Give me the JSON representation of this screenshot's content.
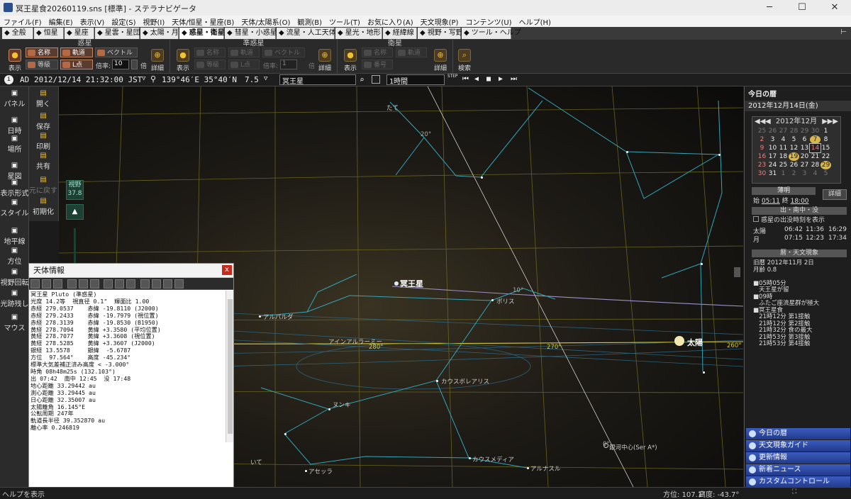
{
  "window": {
    "title": "冥王星食20260119.sns [標準] - ステラナビゲータ"
  },
  "menu": [
    "ファイル(F)",
    "編集(E)",
    "表示(V)",
    "設定(S)",
    "視野(I)",
    "天体/恒星・星座(B)",
    "天体/太陽系(O)",
    "観測(B)",
    "ツール(T)",
    "お気に入り(A)",
    "天文現象(P)",
    "コンテンツ(U)",
    "ヘルプ(H)"
  ],
  "tabs": [
    {
      "label": "全般",
      "icon": "panel-icon"
    },
    {
      "label": "恒星",
      "icon": "star-icon"
    },
    {
      "label": "星座",
      "icon": "constellation-icon"
    },
    {
      "label": "星雲・星団",
      "icon": "nebula-icon"
    },
    {
      "label": "太陽・月",
      "icon": "sun-icon"
    },
    {
      "label": "惑星・衛星",
      "icon": "planet-icon",
      "selected": true
    },
    {
      "label": "彗星・小惑星",
      "icon": "comet-icon"
    },
    {
      "label": "流星・人工天体",
      "icon": "meteor-icon"
    },
    {
      "label": "星光・地形",
      "icon": "landscape-icon"
    },
    {
      "label": "経緯線",
      "icon": "grid-icon"
    },
    {
      "label": "視野・写野",
      "icon": "fov-icon"
    },
    {
      "label": "ツール・ヘルプ",
      "icon": "tools-icon"
    }
  ],
  "ribbon": {
    "planets": {
      "title": "惑星",
      "show": "表示",
      "name": "名称",
      "orbit": "軌道",
      "vector": "ベクトル",
      "magnitude": "等級",
      "lpoint": "L点",
      "scale_label": "倍率:",
      "scale_value": "10",
      "scale_unit": "倍",
      "detail": "詳細"
    },
    "dwarf": {
      "title": "準惑星",
      "show": "表示",
      "name": "名称",
      "orbit": "軌道",
      "vector": "ベクトル",
      "magnitude": "等級",
      "lpoint": "L点",
      "scale_label": "倍率:",
      "scale_value": "1",
      "scale_unit": "倍",
      "detail": "詳細"
    },
    "satellites": {
      "title": "衛星",
      "show": "表示",
      "name": "名称",
      "orbit": "軌道",
      "number": "番号",
      "detail": "詳細"
    },
    "search": "検索"
  },
  "statusline": {
    "era": "AD",
    "datetime": "2012/12/14 21:32:00 JST",
    "location": "139°46′E 35°40′N",
    "height": "7.5",
    "target": "冥王星",
    "step": "1時間",
    "step_label": "STEP"
  },
  "leftbar": [
    {
      "label": "パネル",
      "icon": "panel-icon"
    },
    {
      "label": "日時",
      "icon": "clock-icon"
    },
    {
      "label": "場所",
      "icon": "location-icon"
    },
    {
      "label": "星図",
      "icon": "chart-icon"
    },
    {
      "label": "表示形式",
      "icon": "display-icon"
    },
    {
      "label": "スタイル",
      "icon": "style-icon"
    },
    {
      "label": "地平線",
      "icon": "horizon-icon"
    },
    {
      "label": "方位",
      "icon": "compass-icon"
    },
    {
      "label": "視野回転",
      "icon": "rotate-icon"
    },
    {
      "label": "光跡残し",
      "icon": "trail-icon"
    },
    {
      "label": "マウス",
      "icon": "mouse-icon"
    }
  ],
  "leftbar2": [
    {
      "label": "開く",
      "icon": "open-icon"
    },
    {
      "label": "保存",
      "icon": "save-icon"
    },
    {
      "label": "印刷",
      "icon": "print-icon"
    },
    {
      "label": "共有",
      "icon": "share-icon"
    },
    {
      "label": "元に戻す",
      "icon": "undo-icon"
    },
    {
      "label": "初期化",
      "icon": "reset-icon"
    }
  ],
  "fov": {
    "label": "視野",
    "value": "37.8"
  },
  "sky_labels": {
    "pluto": "冥王星",
    "sun": "太陽",
    "alphard": "アルパルダ",
    "polis": "ポリス",
    "ainalrami": "アインアルラーミー",
    "kaus_borealis": "カウスボレアリス",
    "nunki": "ヌンキ",
    "kaus_media": "カウスメディア",
    "arnasl": "アルナスル",
    "ascella": "アセッラ",
    "gc": "銀河中心(Ser A*)",
    "tate": "たて",
    "ite": "いて",
    "deg280": "280°",
    "deg270": "270°",
    "deg260": "260°",
    "deg20": "20°",
    "deg10": "10°",
    "deg0": "0°"
  },
  "infowin": {
    "title": "天体情報",
    "close": "x",
    "lines": [
      "冥王星 Pluto (準惑星)",
      "光度 14.2等  視直径 0.1\"  輝面比 1.00",
      "赤経 279.0537    赤緯 -19.8110 (J2000)",
      "赤経 279.2433    赤緯 -19.7979 (視位置)",
      "赤経 278.3139    赤緯 -19.8530 (B1950)",
      "黄経 278.7094    黄緯 +3.3580 (平均位置)",
      "黄経 278.7077    黄緯 +3.3608 (視位置)",
      "黄経 278.5285    黄緯 +3.3607 (J2000)",
      "銀経 13.5578     銀緯  -5.6787",
      "方位  97.564°    高度 -45.234°",
      "標準大気差補正済み高度 < -3.000°",
      "時角 08h48m25s (132.103°)",
      "出 07:42  南中 12:45  没 17:48",
      "地心距離 33.29442 au",
      "測心距離 33.29445 au",
      "日心距離 32.35007 au",
      "太陽離角 16.145°E",
      "公転周期 247年",
      "軌道長半径 39.352870 au",
      "離心率 0.246819"
    ]
  },
  "rightpanel": {
    "title": "今日の暦",
    "date": "2012年12月14日(金)",
    "month": "2012年12月",
    "weeks": [
      [
        "25",
        "26",
        "27",
        "28",
        "29",
        "30",
        "1"
      ],
      [
        "2",
        "3",
        "4",
        "5",
        "6",
        "7",
        "8"
      ],
      [
        "9",
        "10",
        "11",
        "12",
        "13",
        "14",
        "15"
      ],
      [
        "16",
        "17",
        "18",
        "19",
        "20",
        "21",
        "22"
      ],
      [
        "23",
        "24",
        "25",
        "26",
        "27",
        "28",
        "29"
      ],
      [
        "30",
        "31",
        "1",
        "2",
        "3",
        "4",
        "5"
      ]
    ],
    "term_label": "薄明",
    "term_start_label": "始",
    "term_start": "05:11",
    "term_end_label": "終",
    "term_end": "18:00",
    "detail": "詳細",
    "rise_title": "出・南中・没",
    "planet_check": "惑星の出没時刻を表示",
    "rise_rows": [
      {
        "name": "太陽",
        "rise": "06:42",
        "transit": "11:36",
        "set": "16:29"
      },
      {
        "name": "月",
        "rise": "07:15",
        "transit": "12:23",
        "set": "17:34"
      }
    ],
    "events_title": "暦・天文現象",
    "events": [
      "旧暦 2012年11月 2日",
      "月齢 0.8",
      "",
      "■05時05分",
      "   天王星が留",
      "■09時",
      "   ふたご座流星群が極大",
      "■冥王星食",
      "   21時12分 第1接触",
      "   21時12分 第2接触",
      "   21時32分 食の最大",
      "   21時53分 第3接触",
      "   21時53分 第4接触"
    ],
    "buttons": [
      "今日の暦",
      "天文現象ガイド",
      "更新情報",
      "新着ニュース",
      "カスタムコントロール"
    ]
  },
  "bottom": {
    "help": "ヘルプを表示",
    "azimuth": "方位: 107.1°",
    "altitude": "高度: -43.7°"
  }
}
